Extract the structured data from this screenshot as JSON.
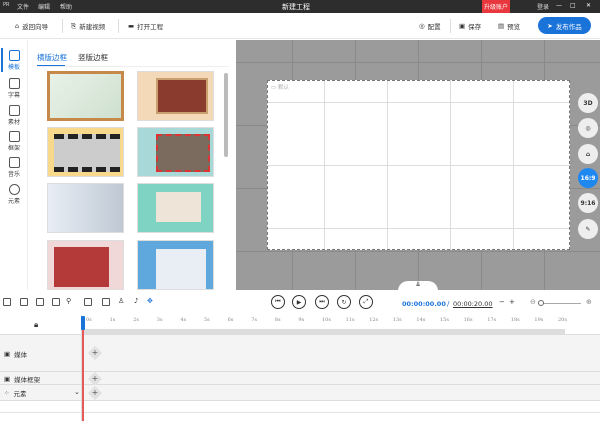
{
  "titlebar": {
    "logo": "PR",
    "menus": [
      "文件",
      "编辑",
      "帮助"
    ],
    "title": "新建工程",
    "upgrade": "升级账户",
    "login": "登录"
  },
  "toolbar": {
    "back": "返回向导",
    "new_video": "新建视频",
    "open": "打开工程",
    "config": "配置",
    "save": "保存",
    "preview": "预览",
    "publish": "发布作品"
  },
  "leftnav": [
    "模板",
    "字幕",
    "素材",
    "框架",
    "音乐",
    "元素"
  ],
  "panel": {
    "tabs": [
      "横版边框",
      "竖版边框"
    ],
    "active_tab": 0,
    "thumbnails": 8
  },
  "canvas": {
    "label": "默认",
    "side_buttons": [
      "3D",
      "rotate",
      "lock",
      "16:9",
      "9:16",
      "edit"
    ],
    "active_ratio": "16:9"
  },
  "controls": {
    "current_time": "00:00:00.00",
    "separator": "/",
    "total_time": "00:00:20.00",
    "minus": "−",
    "plus": "+"
  },
  "ruler": [
    "0s",
    "1s",
    "2s",
    "3s",
    "4s",
    "5s",
    "6s",
    "7s",
    "8s",
    "9s",
    "10s",
    "11s",
    "12s",
    "13s",
    "14s",
    "15s",
    "16s",
    "17s",
    "18s",
    "19s",
    "20s"
  ],
  "tracks": [
    {
      "label": "媒体"
    },
    {
      "label": "媒体框架"
    },
    {
      "label": "元素"
    }
  ],
  "colors": {
    "accent": "#1a73d9",
    "upgrade": "#e8383d",
    "playhead": "#e85a5a"
  }
}
